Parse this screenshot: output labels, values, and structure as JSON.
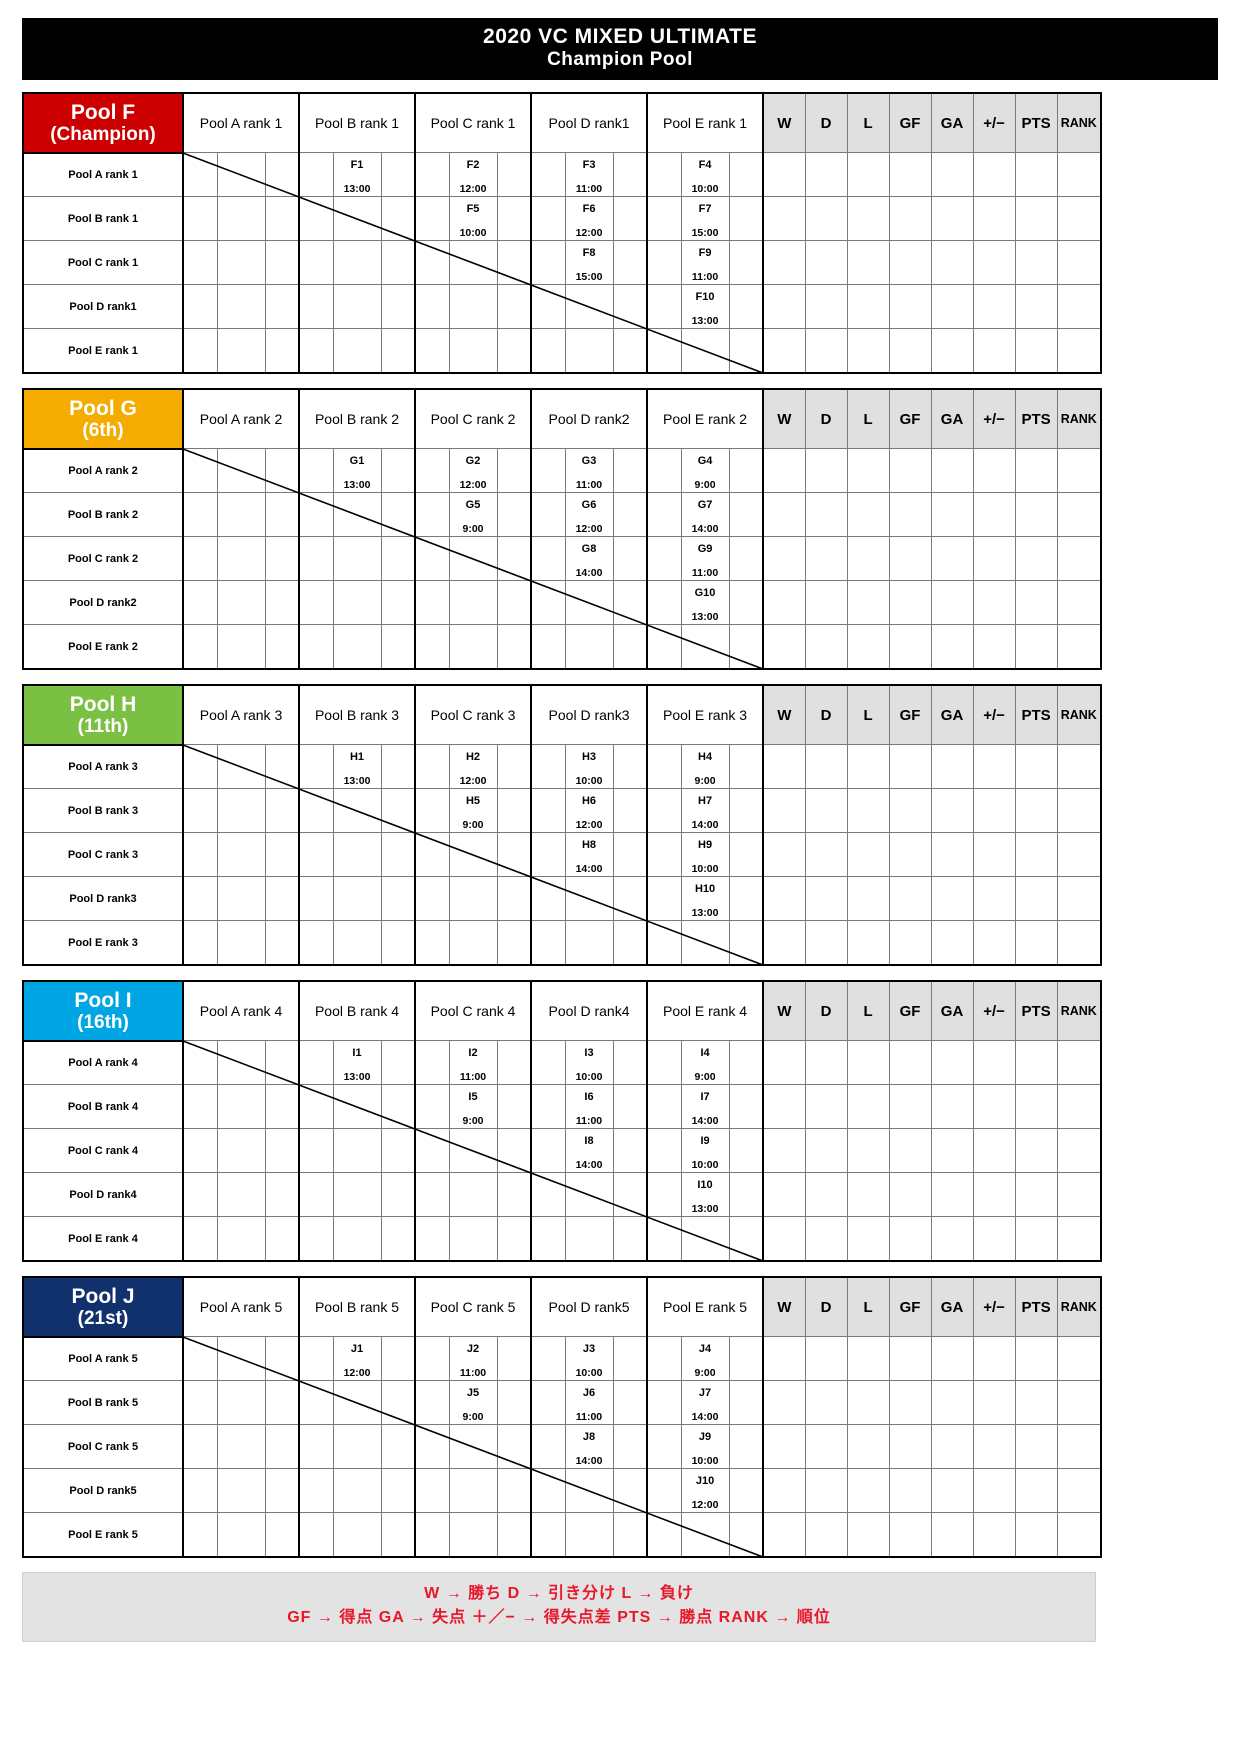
{
  "title": {
    "line1": "2020 VC MIXED ULTIMATE",
    "line2": "Champion Pool"
  },
  "stat_columns": [
    "W",
    "D",
    "L",
    "GF",
    "GA",
    "+/−",
    "PTS",
    "RANK"
  ],
  "pools": [
    {
      "name": "Pool F",
      "placing": "(Champion)",
      "color": "#cc0000",
      "columns": [
        "Pool A rank 1",
        "Pool B rank 1",
        "Pool C rank 1",
        "Pool D rank1",
        "Pool E rank 1"
      ],
      "rows": [
        "Pool A rank 1",
        "Pool B rank 1",
        "Pool C rank 1",
        "Pool D rank1",
        "Pool E rank 1"
      ],
      "matches": [
        [
          null,
          {
            "code": "F1",
            "time": "13:00"
          },
          {
            "code": "F2",
            "time": "12:00"
          },
          {
            "code": "F3",
            "time": "11:00"
          },
          {
            "code": "F4",
            "time": "10:00"
          }
        ],
        [
          null,
          null,
          {
            "code": "F5",
            "time": "10:00"
          },
          {
            "code": "F6",
            "time": "12:00"
          },
          {
            "code": "F7",
            "time": "15:00"
          }
        ],
        [
          null,
          null,
          null,
          {
            "code": "F8",
            "time": "15:00"
          },
          {
            "code": "F9",
            "time": "11:00"
          }
        ],
        [
          null,
          null,
          null,
          null,
          {
            "code": "F10",
            "time": "13:00"
          }
        ],
        [
          null,
          null,
          null,
          null,
          null
        ]
      ]
    },
    {
      "name": "Pool G",
      "placing": "(6th)",
      "color": "#f5ac00",
      "columns": [
        "Pool A rank 2",
        "Pool B rank 2",
        "Pool C rank 2",
        "Pool D rank2",
        "Pool E rank 2"
      ],
      "rows": [
        "Pool A rank 2",
        "Pool B rank 2",
        "Pool C rank 2",
        "Pool D rank2",
        "Pool E rank 2"
      ],
      "matches": [
        [
          null,
          {
            "code": "G1",
            "time": "13:00"
          },
          {
            "code": "G2",
            "time": "12:00"
          },
          {
            "code": "G3",
            "time": "11:00"
          },
          {
            "code": "G4",
            "time": "9:00"
          }
        ],
        [
          null,
          null,
          {
            "code": "G5",
            "time": "9:00"
          },
          {
            "code": "G6",
            "time": "12:00"
          },
          {
            "code": "G7",
            "time": "14:00"
          }
        ],
        [
          null,
          null,
          null,
          {
            "code": "G8",
            "time": "14:00"
          },
          {
            "code": "G9",
            "time": "11:00"
          }
        ],
        [
          null,
          null,
          null,
          null,
          {
            "code": "G10",
            "time": "13:00"
          }
        ],
        [
          null,
          null,
          null,
          null,
          null
        ]
      ]
    },
    {
      "name": "Pool H",
      "placing": "(11th)",
      "color": "#7ac143",
      "columns": [
        "Pool A rank 3",
        "Pool B rank 3",
        "Pool C rank 3",
        "Pool D rank3",
        "Pool E rank 3"
      ],
      "rows": [
        "Pool A rank 3",
        "Pool B rank 3",
        "Pool C rank 3",
        "Pool D rank3",
        "Pool E rank 3"
      ],
      "matches": [
        [
          null,
          {
            "code": "H1",
            "time": "13:00"
          },
          {
            "code": "H2",
            "time": "12:00"
          },
          {
            "code": "H3",
            "time": "10:00"
          },
          {
            "code": "H4",
            "time": "9:00"
          }
        ],
        [
          null,
          null,
          {
            "code": "H5",
            "time": "9:00"
          },
          {
            "code": "H6",
            "time": "12:00"
          },
          {
            "code": "H7",
            "time": "14:00"
          }
        ],
        [
          null,
          null,
          null,
          {
            "code": "H8",
            "time": "14:00"
          },
          {
            "code": "H9",
            "time": "10:00"
          }
        ],
        [
          null,
          null,
          null,
          null,
          {
            "code": "H10",
            "time": "13:00"
          }
        ],
        [
          null,
          null,
          null,
          null,
          null
        ]
      ]
    },
    {
      "name": "Pool I",
      "placing": "(16th)",
      "color": "#00a5e3",
      "columns": [
        "Pool A rank 4",
        "Pool B rank 4",
        "Pool C rank 4",
        "Pool D rank4",
        "Pool E rank 4"
      ],
      "rows": [
        "Pool A rank 4",
        "Pool B rank 4",
        "Pool C rank 4",
        "Pool D rank4",
        "Pool E rank 4"
      ],
      "matches": [
        [
          null,
          {
            "code": "I1",
            "time": "13:00"
          },
          {
            "code": "I2",
            "time": "11:00"
          },
          {
            "code": "I3",
            "time": "10:00"
          },
          {
            "code": "I4",
            "time": "9:00"
          }
        ],
        [
          null,
          null,
          {
            "code": "I5",
            "time": "9:00"
          },
          {
            "code": "I6",
            "time": "11:00"
          },
          {
            "code": "I7",
            "time": "14:00"
          }
        ],
        [
          null,
          null,
          null,
          {
            "code": "I8",
            "time": "14:00"
          },
          {
            "code": "I9",
            "time": "10:00"
          }
        ],
        [
          null,
          null,
          null,
          null,
          {
            "code": "I10",
            "time": "13:00"
          }
        ],
        [
          null,
          null,
          null,
          null,
          null
        ]
      ]
    },
    {
      "name": "Pool J",
      "placing": "(21st)",
      "color": "#10316b",
      "columns": [
        "Pool A rank 5",
        "Pool B rank 5",
        "Pool C rank 5",
        "Pool D rank5",
        "Pool E rank 5"
      ],
      "rows": [
        "Pool A rank 5",
        "Pool B rank 5",
        "Pool C rank 5",
        "Pool D rank5",
        "Pool E rank 5"
      ],
      "matches": [
        [
          null,
          {
            "code": "J1",
            "time": "12:00"
          },
          {
            "code": "J2",
            "time": "11:00"
          },
          {
            "code": "J3",
            "time": "10:00"
          },
          {
            "code": "J4",
            "time": "9:00"
          }
        ],
        [
          null,
          null,
          {
            "code": "J5",
            "time": "9:00"
          },
          {
            "code": "J6",
            "time": "11:00"
          },
          {
            "code": "J7",
            "time": "14:00"
          }
        ],
        [
          null,
          null,
          null,
          {
            "code": "J8",
            "time": "14:00"
          },
          {
            "code": "J9",
            "time": "10:00"
          }
        ],
        [
          null,
          null,
          null,
          null,
          {
            "code": "J10",
            "time": "12:00"
          }
        ],
        [
          null,
          null,
          null,
          null,
          null
        ]
      ]
    }
  ],
  "legend": {
    "color": "#e8172a",
    "line1": "W  →  勝ち    D  →  引き分け    L  →  負け",
    "line2": "GF  →  得点    GA  →  失点    ＋／−  →  得失点差    PTS  →  勝点    RANK  →  順位"
  }
}
